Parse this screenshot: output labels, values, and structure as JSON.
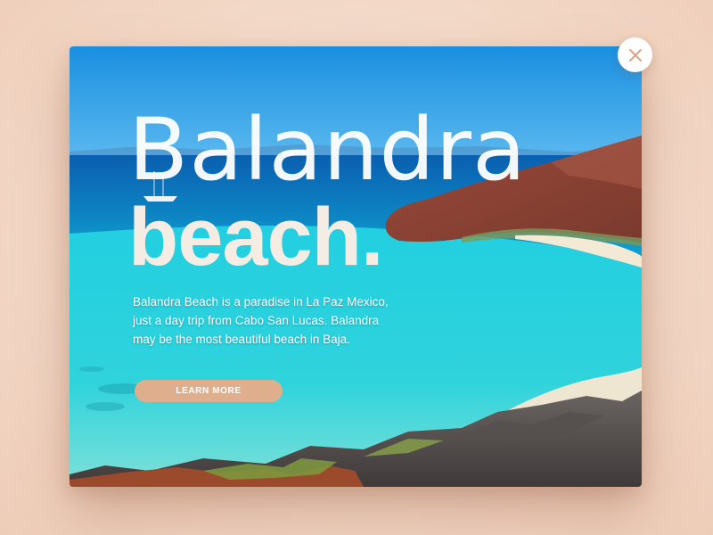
{
  "hero": {
    "title_line1": "Balandra",
    "title_line2": "beach.",
    "description": "Balandra Beach is a paradise in La Paz Mexico, just a day trip from Cabo San Lucas. Balandra may be the most beautiful beach in Baja.",
    "cta_label": "LEARN MORE"
  },
  "close": {
    "icon": "close-icon"
  },
  "colors": {
    "accent": "#dfae8d",
    "close_icon": "#d9a483",
    "backdrop": "#f3d9c8",
    "sea": "#19c6d6",
    "sky": "#1f9be6"
  }
}
